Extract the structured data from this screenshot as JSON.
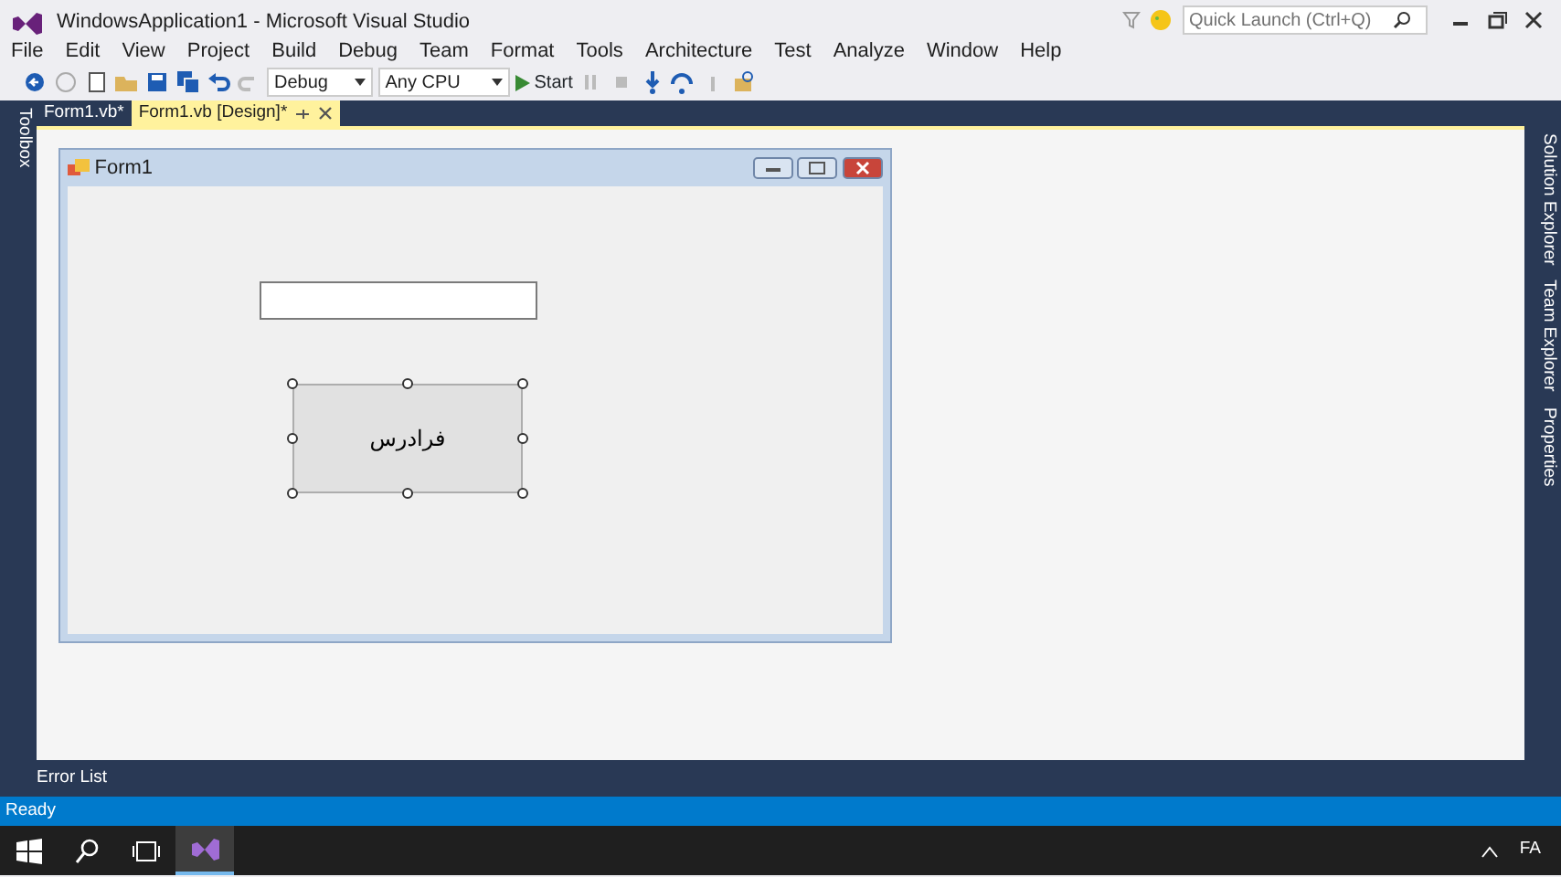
{
  "window": {
    "title": "WindowsApplication1 - Microsoft Visual Studio"
  },
  "quick_launch": {
    "placeholder": "Quick Launch (Ctrl+Q)"
  },
  "menu": [
    "File",
    "Edit",
    "View",
    "Project",
    "Build",
    "Debug",
    "Team",
    "Format",
    "Tools",
    "Architecture",
    "Test",
    "Analyze",
    "Window",
    "Help"
  ],
  "toolbar": {
    "configuration": "Debug",
    "platform": "Any CPU",
    "start": "Start"
  },
  "left_side_tabs": [
    "Toolbox"
  ],
  "document_tabs": [
    {
      "label": "Form1.vb*",
      "selected": false
    },
    {
      "label": "Form1.vb [Design]*",
      "selected": true
    }
  ],
  "right_side_tabs": [
    "Solution Explorer",
    "Team Explorer",
    "Properties"
  ],
  "designer_form": {
    "title": "Form1",
    "button": {
      "label": "فرادرس",
      "selected": true
    }
  },
  "bottom_tabs": [
    "Error List"
  ],
  "status_bar": {
    "text": "Ready"
  },
  "taskbar": {
    "language": "FA"
  }
}
